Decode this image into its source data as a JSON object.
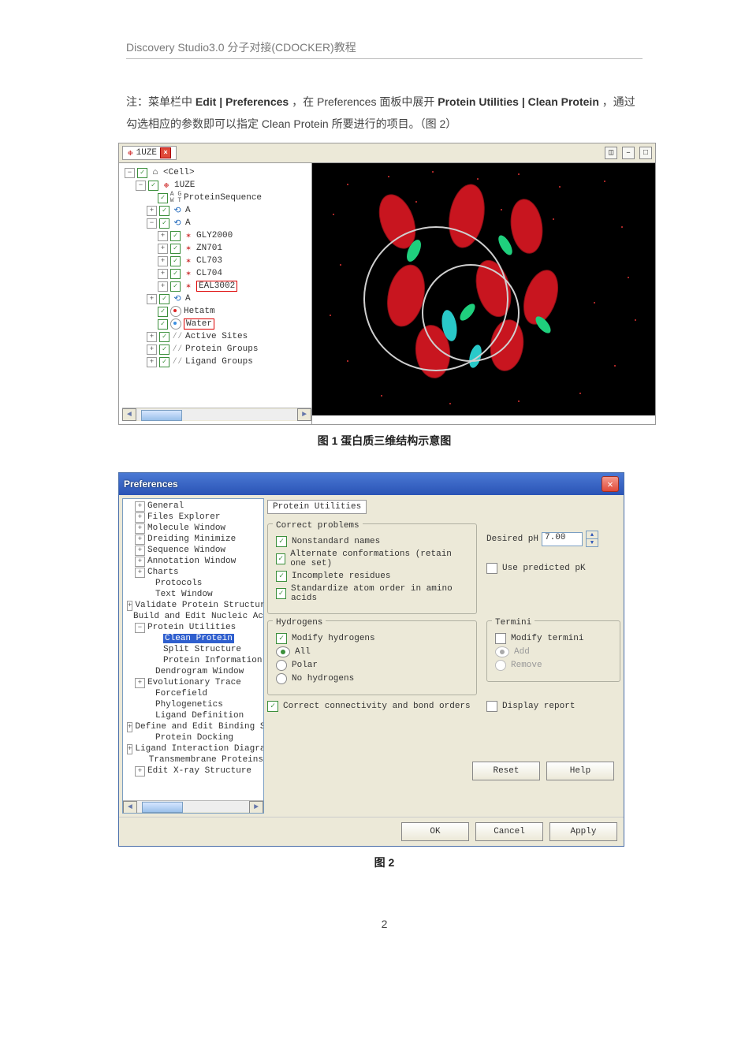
{
  "header": "Discovery Studio3.0 分子对接(CDOCKER)教程",
  "intro_before_bold1": "注：菜单栏中 ",
  "bold1": "Edit | Preferences",
  "intro_mid1": "，在 Preferences 面板中展开 ",
  "bold2": "Protein Utilities | Clean Protein",
  "intro_after": "，通过勾选相应的参数即可以指定 Clean Protein 所要进行的项目。（图 2）",
  "fig1_caption": "图 1   蛋白质三维结构示意图",
  "fig2_caption": "图 2",
  "page_number": "2",
  "shot1": {
    "tab_label": "1UZE",
    "tree": {
      "root": "<Cell>",
      "struct": "1UZE",
      "seq": "ProteinSequence",
      "chainA1": "A",
      "chainA2": "A",
      "res": [
        "GLY2000",
        "ZN701",
        "CL703",
        "CL704",
        "EAL3002"
      ],
      "chainA3": "A",
      "hetatm": "Hetatm",
      "water": "Water",
      "groups": [
        "Active Sites",
        "Protein Groups",
        "Ligand Groups"
      ]
    }
  },
  "prefs": {
    "window_title": "Preferences",
    "tree": [
      {
        "t": "General",
        "x": 1,
        "p": 1
      },
      {
        "t": "Files Explorer",
        "x": 1,
        "p": 1
      },
      {
        "t": "Molecule Window",
        "x": 1,
        "p": 1
      },
      {
        "t": "Dreiding Minimize",
        "x": 1,
        "p": 1
      },
      {
        "t": "Sequence Window",
        "x": 1,
        "p": 1
      },
      {
        "t": "Annotation Window",
        "x": 1,
        "p": 1
      },
      {
        "t": "Charts",
        "x": 1,
        "p": 1
      },
      {
        "t": "Protocols",
        "x": 2,
        "p": 0
      },
      {
        "t": "Text Window",
        "x": 2,
        "p": 0
      },
      {
        "t": "Validate Protein Structur",
        "x": 1,
        "p": 1
      },
      {
        "t": "Build and Edit Nucleic Ac",
        "x": 1,
        "p": 0
      },
      {
        "t": "Protein Utilities",
        "x": 1,
        "p": 2
      },
      {
        "t": "Clean Protein",
        "x": 3,
        "p": 0,
        "sel": 1
      },
      {
        "t": "Split Structure",
        "x": 3,
        "p": 0
      },
      {
        "t": "Protein Information",
        "x": 3,
        "p": 0
      },
      {
        "t": "Dendrogram Window",
        "x": 2,
        "p": 0
      },
      {
        "t": "Evolutionary Trace",
        "x": 1,
        "p": 1
      },
      {
        "t": "Forcefield",
        "x": 2,
        "p": 0
      },
      {
        "t": "Phylogenetics",
        "x": 2,
        "p": 0
      },
      {
        "t": "Ligand Definition",
        "x": 2,
        "p": 0
      },
      {
        "t": "Define and Edit Binding S",
        "x": 1,
        "p": 1
      },
      {
        "t": "Protein Docking",
        "x": 2,
        "p": 0
      },
      {
        "t": "Ligand Interaction Diagra",
        "x": 1,
        "p": 1
      },
      {
        "t": "Transmembrane Proteins",
        "x": 2,
        "p": 0
      },
      {
        "t": "Edit X-ray Structure",
        "x": 1,
        "p": 1
      }
    ],
    "right_title": "Protein Utilities",
    "correct": {
      "group": "Correct problems",
      "nonstd": "Nonstandard names",
      "alt": "Alternate conformations (retain one set)",
      "incomplete": "Incomplete residues",
      "std": "Standardize atom order in amino acids"
    },
    "ph": {
      "label": "Desired pH",
      "value": "7.00",
      "predicted": "Use predicted pK"
    },
    "hyd": {
      "group": "Hydrogens",
      "modify": "Modify hydrogens",
      "all": "All",
      "polar": "Polar",
      "none": "No hydrogens"
    },
    "termini": {
      "group": "Termini",
      "modify": "Modify termini",
      "add": "Add",
      "remove": "Remove"
    },
    "conn": "Correct connectivity and bond orders",
    "disp": "Display report",
    "buttons": {
      "reset": "Reset",
      "help": "Help",
      "ok": "OK",
      "cancel": "Cancel",
      "apply": "Apply"
    }
  }
}
